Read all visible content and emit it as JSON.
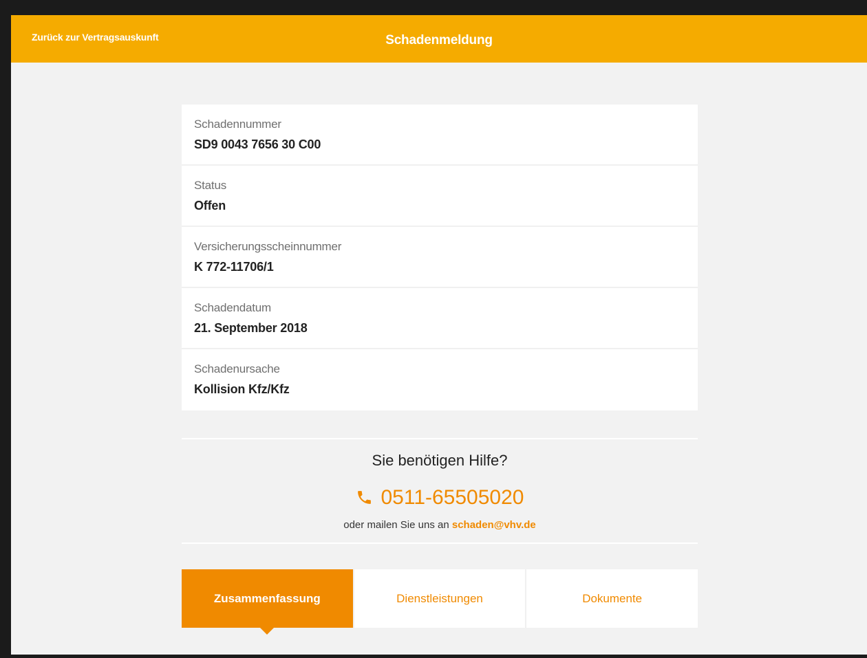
{
  "header": {
    "back_label": "Zurück zur Vertragsauskunft",
    "title": "Schadenmeldung"
  },
  "fields": [
    {
      "label": "Schadennummer",
      "value": "SD9 0043 7656 30 C00"
    },
    {
      "label": "Status",
      "value": "Offen"
    },
    {
      "label": "Versicherungsscheinnummer",
      "value": "K 772-11706/1"
    },
    {
      "label": "Schadendatum",
      "value": "21. September 2018"
    },
    {
      "label": "Schadenursache",
      "value": "Kollision Kfz/Kfz"
    }
  ],
  "help": {
    "title": "Sie benötigen Hilfe?",
    "phone": "0511-65505020",
    "phone_icon": "phone-icon",
    "mail_prefix": "oder mailen Sie uns an",
    "email": "schaden@vhv.de"
  },
  "tabs": [
    {
      "label": "Zusammenfassung",
      "active": true
    },
    {
      "label": "Dienstleistungen",
      "active": false
    },
    {
      "label": "Dokumente",
      "active": false
    }
  ],
  "colors": {
    "header": "#f5ab00",
    "accent": "#f08a00",
    "background": "#f2f2f2"
  }
}
